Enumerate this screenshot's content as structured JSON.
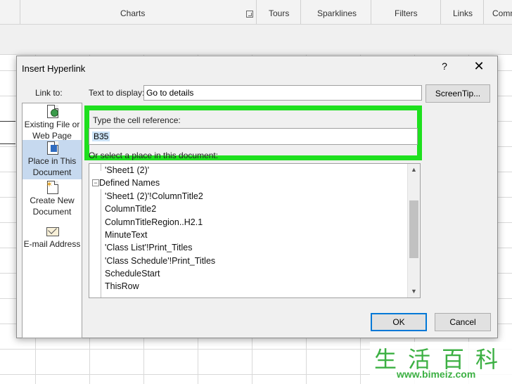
{
  "ribbon": {
    "groups": [
      "Charts",
      "Tours",
      "Sparklines",
      "Filters",
      "Links",
      "Comn"
    ]
  },
  "dialog": {
    "title": "Insert Hyperlink",
    "help": "?",
    "close": "✕",
    "link_to_label": "Link to:",
    "link_to_items": [
      {
        "label": "Existing File or Web Page",
        "icon": "web-page-icon"
      },
      {
        "label": "Place in This Document",
        "icon": "document-place-icon",
        "selected": true
      },
      {
        "label": "Create New Document",
        "icon": "new-document-icon"
      },
      {
        "label": "E-mail Address",
        "icon": "email-icon"
      }
    ],
    "text_to_display_label": "Text to display:",
    "text_to_display_value": "Go to details",
    "screentip_label": "ScreenTip...",
    "cell_reference_label": "Type the cell reference:",
    "cell_reference_value": "B35",
    "or_select_label": "Or select a place in this document:",
    "tree": {
      "top_item": "'Sheet1 (2)'",
      "group_label": "Defined Names",
      "group_toggle": "−",
      "items": [
        "'Sheet1 (2)'!ColumnTitle2",
        "ColumnTitle2",
        "ColumnTitleRegion..H2.1",
        "MinuteText",
        "'Class List'!Print_Titles",
        "'Class Schedule'!Print_Titles",
        "ScheduleStart",
        "ThisRow"
      ]
    },
    "ok_label": "OK",
    "cancel_label": "Cancel"
  },
  "watermark": {
    "chars": "生活百科",
    "url": "www.bimeiz.com"
  },
  "colors": {
    "highlight": "#1ee01e",
    "selected_bg": "#c6d9ef",
    "ok_border": "#0078d7"
  }
}
